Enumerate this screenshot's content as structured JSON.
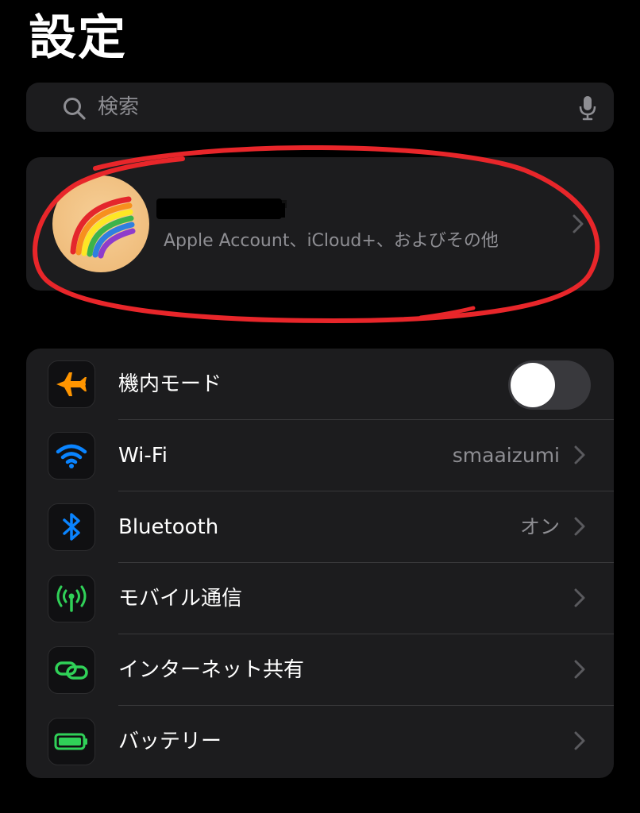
{
  "header": {
    "title": "設定"
  },
  "search": {
    "placeholder": "検索"
  },
  "account": {
    "subtitle": "Apple Account、iCloud+、およびその他"
  },
  "settings": [
    {
      "label": "機内モード",
      "icon": "airplane-icon",
      "color": "#ff9500",
      "toggle": false
    },
    {
      "label": "Wi-Fi",
      "value": "smaaizumi",
      "icon": "wifi-icon",
      "color": "#0a84ff"
    },
    {
      "label": "Bluetooth",
      "value": "オン",
      "icon": "bluetooth-icon",
      "color": "#0a84ff"
    },
    {
      "label": "モバイル通信",
      "icon": "antenna-icon",
      "color": "#30d158"
    },
    {
      "label": "インターネット共有",
      "icon": "chain-link-icon",
      "color": "#30d158"
    },
    {
      "label": "バッテリー",
      "icon": "battery-icon",
      "color": "#30d158"
    }
  ],
  "annotation": {
    "color": "#e8262a"
  }
}
